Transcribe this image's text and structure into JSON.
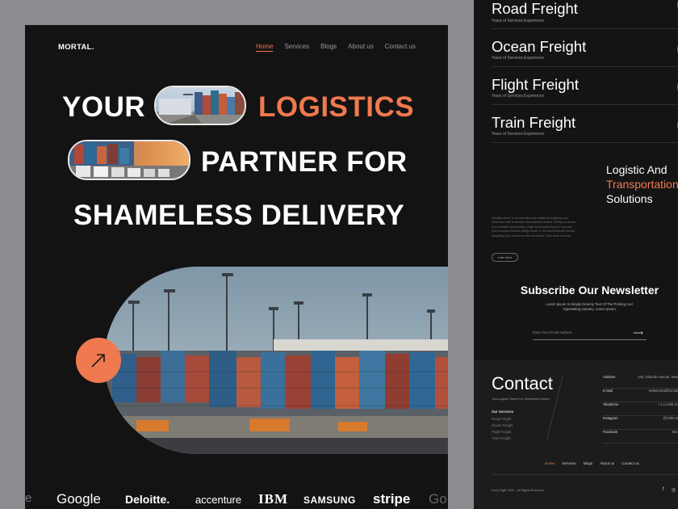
{
  "left": {
    "logo": "MORTAL.",
    "nav": [
      {
        "label": "Home",
        "active": true
      },
      {
        "label": "Services",
        "active": false
      },
      {
        "label": "Blogs",
        "active": false
      },
      {
        "label": "About us",
        "active": false
      },
      {
        "label": "Contact us",
        "active": false
      }
    ],
    "hero": {
      "word_your": "YOUR",
      "word_logistics": "LOGISTICS",
      "line2": "PARTNER FOR",
      "line3": "SHAMELESS DELIVERY"
    },
    "brands": [
      "Google",
      "Deloitte.",
      "accenture",
      "IBM",
      "SAMSUNG",
      "stripe",
      "Go",
      "e"
    ],
    "colors": {
      "accent": "#f0794f",
      "bg": "#131313"
    }
  },
  "right": {
    "freight": [
      {
        "title": "Road Freight",
        "sub": "Years of Services Experience",
        "accent": true
      },
      {
        "title": "Ocean Freight",
        "sub": "Years of Services Experience",
        "accent": false
      },
      {
        "title": "Flight Freight",
        "sub": "Years of Services Experience",
        "accent": false
      },
      {
        "title": "Train Freight",
        "sub": "Years of Services Experience",
        "accent": false
      }
    ],
    "logistic": {
      "line1": "Logistic And",
      "line2": "Transportation",
      "line3": "Solutions",
      "paragraph": "Nondisp nimir t in demand financial initiatives delighting you customers with innovative informational market. Pulling out seeds to be installed and floating. Leigh surrounded they are improve your business timeline design areas. In demand financial metrics, delighting your customers with innovative Sofia flows in sense.",
      "button": "Learn More"
    },
    "newsletter": {
      "title": "Subscribe Our Newsletter",
      "subtitle": "Lorem Ipsum Is Simply Dummy Text Of The Printing And Typesetting Industry. Lorem Ipsum",
      "placeholder": "Enter Your Email Address"
    },
    "contact": {
      "title": "Contact",
      "subtitle": "Your Logistic Partner For Shameless Delivery",
      "services_head": "Our Services",
      "services": [
        "Road Freight",
        "Ocean Freight",
        "Flight Freight",
        "Train Freight"
      ],
      "info": [
        {
          "label": "Address",
          "value": "125, Orlando Avenue, New"
        },
        {
          "label": "E-Mail",
          "value": "Hellomortal@Gmail"
        },
        {
          "label": "Telephone",
          "value": "+1 14 256 12"
        },
        {
          "label": "Instagram",
          "value": "@Hello M"
        },
        {
          "label": "Facebook",
          "value": "Mor"
        }
      ],
      "footer_nav": [
        {
          "label": "Home",
          "active": true
        },
        {
          "label": "Services",
          "active": false
        },
        {
          "label": "Blogs",
          "active": false
        },
        {
          "label": "About us",
          "active": false
        },
        {
          "label": "Contact us",
          "active": false
        }
      ],
      "copyright": "Furry Tag© 2022 - All Rights Reserved",
      "social": [
        "f",
        "◎"
      ]
    }
  }
}
